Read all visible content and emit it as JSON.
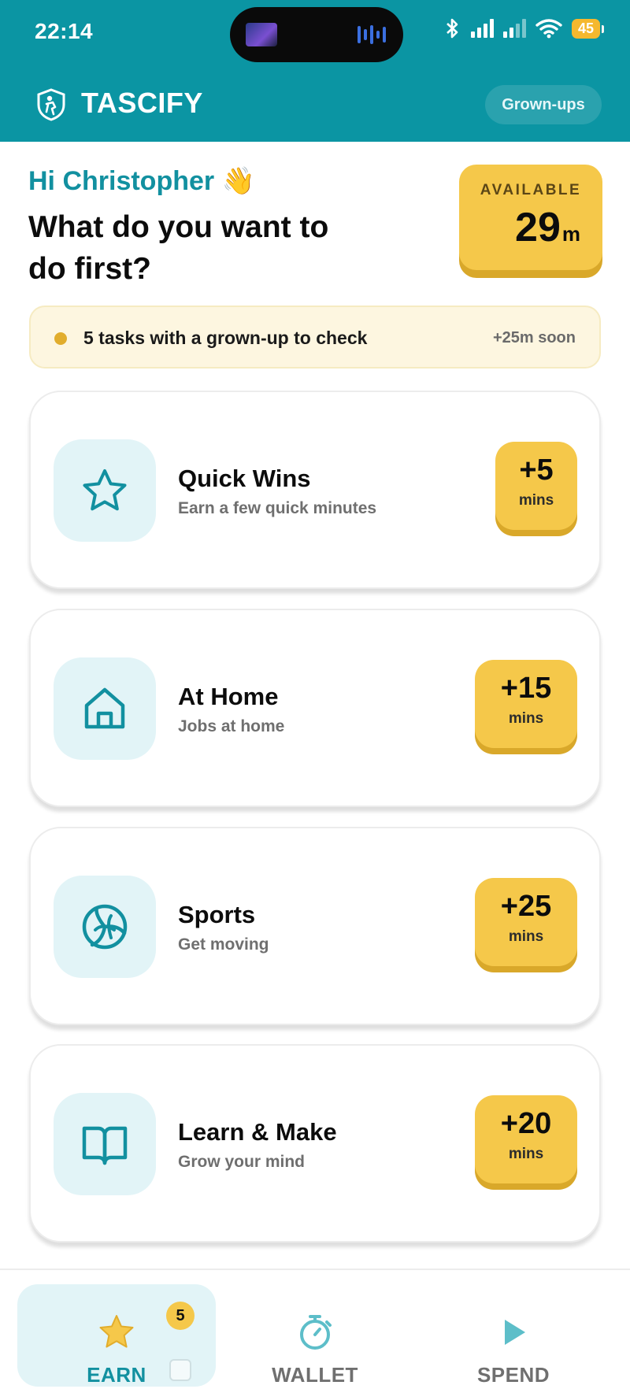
{
  "status_bar": {
    "time": "22:14",
    "battery": "45"
  },
  "header": {
    "brand": "TASCIFY",
    "grownups_label": "Grown-ups"
  },
  "greeting": {
    "hello": "Hi Christopher 👋",
    "question": "What do you want to do first?"
  },
  "available": {
    "label": "AVAILABLE",
    "value": "29",
    "unit": "m"
  },
  "notice": {
    "text": "5 tasks with a grown-up to check",
    "soon": "+25m soon"
  },
  "categories": [
    {
      "title": "Quick Wins",
      "subtitle": "Earn a few quick minutes",
      "reward": "+5",
      "unit": "mins",
      "icon": "star-icon"
    },
    {
      "title": "At Home",
      "subtitle": "Jobs at home",
      "reward": "+15",
      "unit": "mins",
      "icon": "house-icon"
    },
    {
      "title": "Sports",
      "subtitle": "Get moving",
      "reward": "+25",
      "unit": "mins",
      "icon": "volleyball-icon"
    },
    {
      "title": "Learn & Make",
      "subtitle": "Grow your mind",
      "reward": "+20",
      "unit": "mins",
      "icon": "book-icon"
    }
  ],
  "nav": {
    "items": [
      {
        "label": "EARN",
        "icon": "star-icon",
        "active": true,
        "badge": "5"
      },
      {
        "label": "WALLET",
        "icon": "stopwatch-icon",
        "active": false
      },
      {
        "label": "SPEND",
        "icon": "play-icon",
        "active": false
      }
    ]
  },
  "colors": {
    "teal": "#0b95a3",
    "gold": "#f5c84a",
    "light_teal": "#e2f4f7"
  }
}
